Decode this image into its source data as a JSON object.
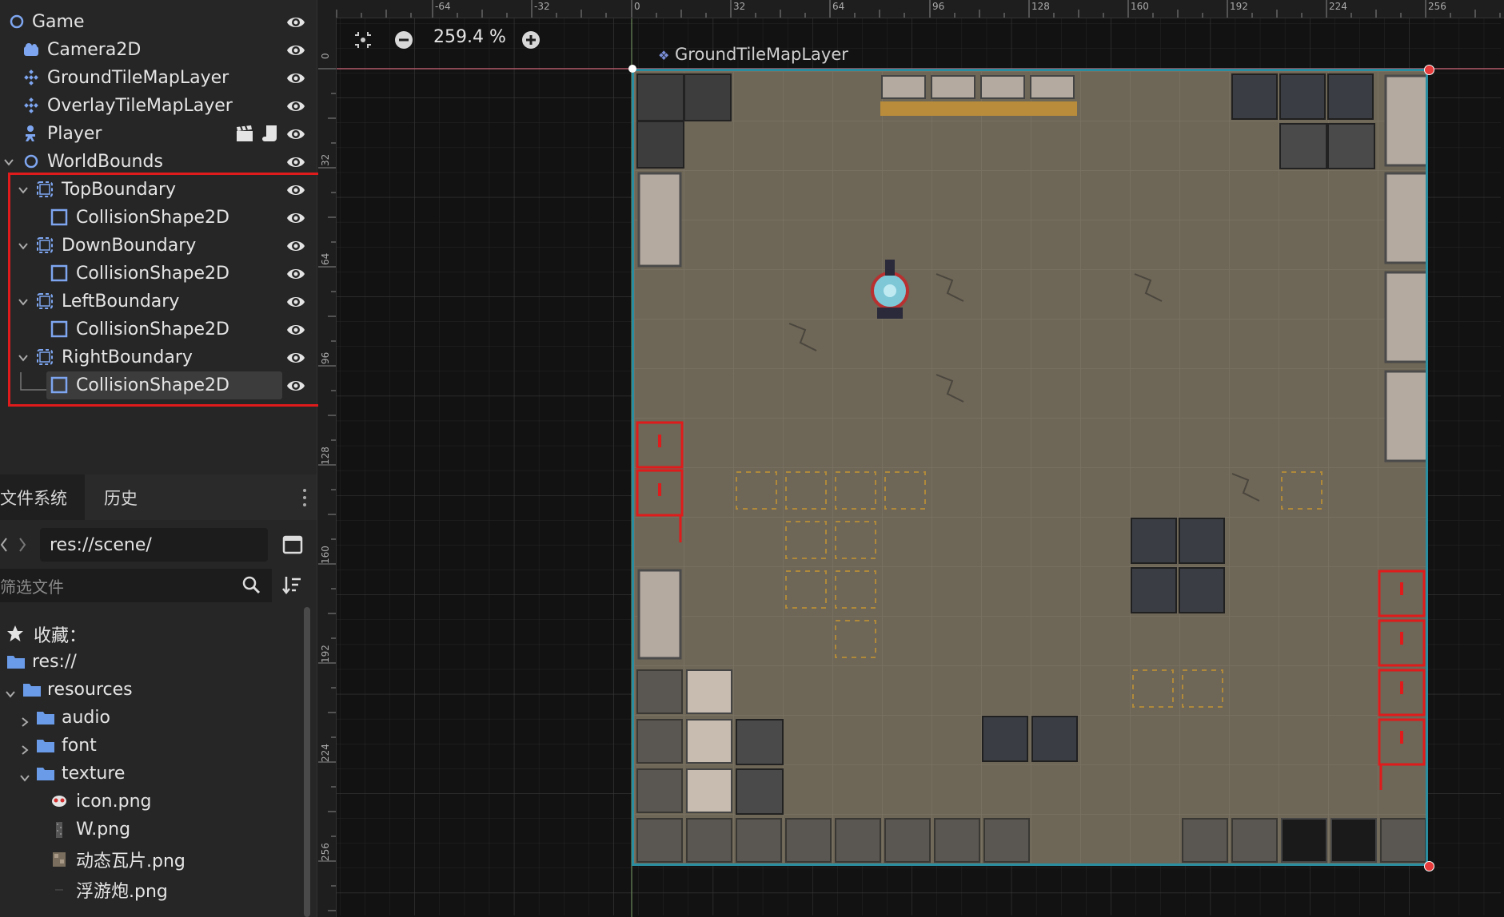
{
  "scene_tree": {
    "nodes": [
      {
        "label": "Game",
        "icon": "node2d-icon",
        "indent": 0
      },
      {
        "label": "Camera2D",
        "icon": "camera2d-icon",
        "indent": 1
      },
      {
        "label": "GroundTileMapLayer",
        "icon": "tilemap-icon",
        "indent": 1
      },
      {
        "label": "OverlayTileMapLayer",
        "icon": "tilemap-icon",
        "indent": 1
      },
      {
        "label": "Player",
        "icon": "character-icon",
        "indent": 1
      },
      {
        "label": "WorldBounds",
        "icon": "node2d-icon",
        "indent": 1
      },
      {
        "label": "TopBoundary",
        "icon": "staticbody-icon",
        "indent": 2
      },
      {
        "label": "CollisionShape2D",
        "icon": "collisionshape-icon",
        "indent": 3
      },
      {
        "label": "DownBoundary",
        "icon": "staticbody-icon",
        "indent": 2
      },
      {
        "label": "CollisionShape2D",
        "icon": "collisionshape-icon",
        "indent": 3
      },
      {
        "label": "LeftBoundary",
        "icon": "staticbody-icon",
        "indent": 2
      },
      {
        "label": "CollisionShape2D",
        "icon": "collisionshape-icon",
        "indent": 3
      },
      {
        "label": "RightBoundary",
        "icon": "staticbody-icon",
        "indent": 2
      },
      {
        "label": "CollisionShape2D",
        "icon": "collisionshape-icon",
        "indent": 3
      }
    ],
    "selected_index": 13
  },
  "filesystem": {
    "tabs": [
      "文件系统",
      "历史"
    ],
    "path": "res://scene/",
    "filter_placeholder": "筛选文件",
    "favorites_label": "收藏：",
    "items": [
      {
        "label": "res://",
        "icon": "folder-icon"
      },
      {
        "label": "resources",
        "icon": "folder-icon"
      },
      {
        "label": "audio",
        "icon": "folder-icon"
      },
      {
        "label": "font",
        "icon": "folder-icon"
      },
      {
        "label": "texture",
        "icon": "folder-icon"
      },
      {
        "label": "icon.png",
        "icon": "image-file-icon"
      },
      {
        "label": "W.png",
        "icon": "image-file-icon"
      },
      {
        "label": "动态瓦片.png",
        "icon": "image-file-icon"
      },
      {
        "label": "浮游炮.png",
        "icon": "image-file-icon"
      }
    ]
  },
  "viewport": {
    "zoom": "259.4 %",
    "layer_label": "GroundTileMapLayer",
    "ruler_top": [
      "-64",
      "-32",
      "0",
      "32",
      "64",
      "96",
      "128",
      "160",
      "192",
      "224",
      "256"
    ],
    "ruler_left": [
      "0",
      "32",
      "64",
      "96",
      "128",
      "160",
      "192",
      "224",
      "256"
    ]
  },
  "colors": {
    "highlight": "#e01b1b",
    "map_border": "#2a8ea0",
    "floor": "#6e6656",
    "accent_blue": "#5a8ee8"
  }
}
